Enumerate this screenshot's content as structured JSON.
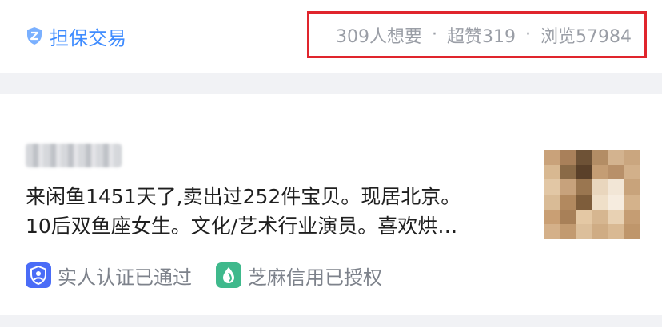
{
  "top": {
    "guarantee_label": "担保交易",
    "stats": {
      "wants": "309人想要",
      "likes": "超赞319",
      "views": "浏览57984",
      "separator": "·"
    },
    "highlight_color": "#e0252d"
  },
  "seller": {
    "bio_line1": "来闲鱼1451天了,卖出过252件宝贝。现居北京。",
    "bio_line2": "10后双鱼座女生。文化/艺术行业演员。喜欢烘…",
    "badges": [
      {
        "label": "实人认证已通过",
        "icon": "person-verify-icon"
      },
      {
        "label": "芝麻信用已授权",
        "icon": "sesame-credit-icon"
      }
    ]
  },
  "colors": {
    "accent": "#3f8cff",
    "muted": "#9a9ea6",
    "text": "#1f1f1f"
  }
}
